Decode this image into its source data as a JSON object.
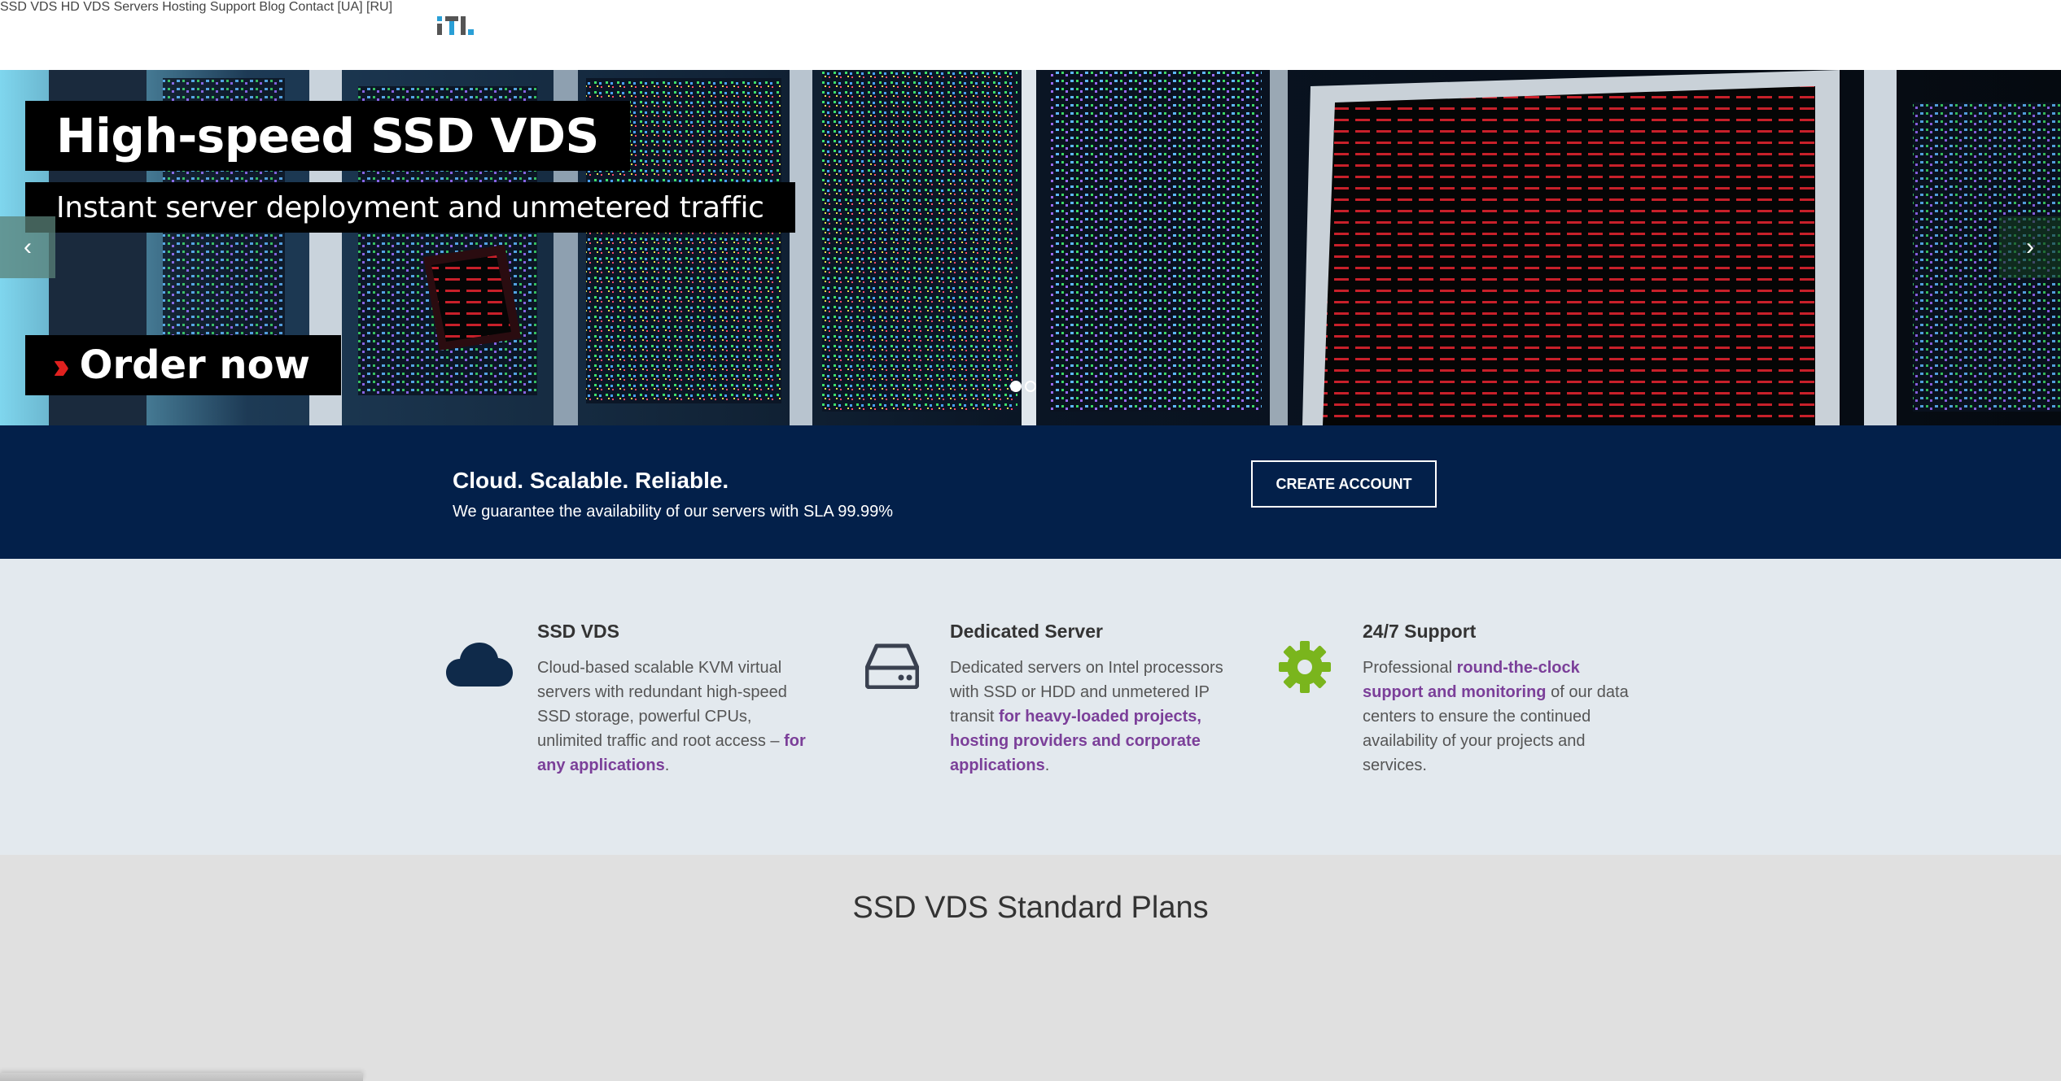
{
  "nav": {
    "items": [
      "SSD VDS",
      "HD VDS",
      "Servers",
      "Hosting",
      "Support",
      "Blog",
      "Contact",
      "[UA]",
      "[RU]"
    ]
  },
  "hero": {
    "title": "High-speed SSD VDS",
    "subtitle": "Instant server deployment and unmetered traffic",
    "order_label": "Order now",
    "prev_icon": "chevron-left-icon",
    "next_icon": "chevron-right-icon",
    "slides_total": 2,
    "active_slide": 1
  },
  "banner": {
    "title": "Cloud. Scalable. Reliable.",
    "text": "We guarantee the availability of our servers with SLA 99.99%",
    "button": "CREATE ACCOUNT"
  },
  "features": [
    {
      "icon": "cloud-icon",
      "title": "SSD VDS",
      "text_plain": "Cloud-based scalable KVM virtual servers with redundant high-speed SSD storage, powerful CPUs, unlimited traffic and root access – ",
      "text_highlight": "for any applications",
      "text_end": "."
    },
    {
      "icon": "hard-drive-icon",
      "title": "Dedicated Server",
      "text_plain": "Dedicated servers on Intel processors with SSD or HDD and unmetered IP transit ",
      "text_highlight": "for heavy-loaded projects, hosting providers and corporate applications",
      "text_end": "."
    },
    {
      "icon": "gear-icon",
      "title": "24/7 Support",
      "text_start": "Professional ",
      "text_highlight": "round-the-clock support and monitoring",
      "text_plain": " of our data centers to ensure the continued availability of your projects and services."
    }
  ],
  "plans": {
    "title": "SSD VDS Standard Plans"
  },
  "colors": {
    "banner_bg": "#03204a",
    "highlight": "#7b3f99",
    "gear": "#7ab51d",
    "cloud": "#0f2a4a",
    "order_chevron": "#e0211f"
  }
}
